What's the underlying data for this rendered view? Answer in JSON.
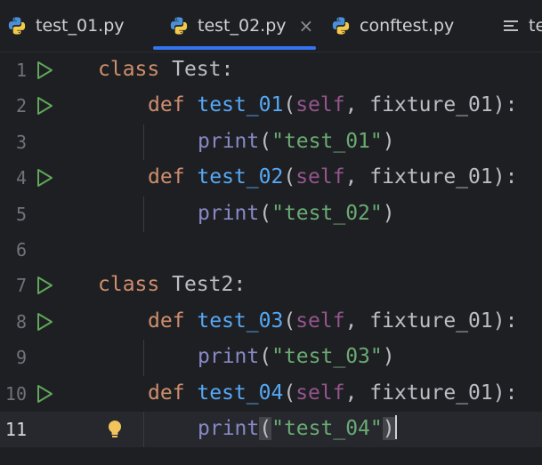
{
  "tabs": [
    {
      "label": "test_01.py",
      "icon": "python-file-icon",
      "active": false
    },
    {
      "label": "test_02.py",
      "icon": "python-file-icon",
      "active": true,
      "close": "×"
    },
    {
      "label": "conftest.py",
      "icon": "python-file-icon",
      "active": false
    },
    {
      "label": "te",
      "icon": "text-file-icon",
      "active": false
    }
  ],
  "colors": {
    "accent": "#3574f0",
    "keyword": "#cf8e6d",
    "function": "#56a8f5",
    "self": "#94558d",
    "builtin": "#8888c6",
    "string": "#6aab73",
    "run_icon": "#5fa759"
  },
  "editor": {
    "lines": [
      {
        "num": "1",
        "run": true,
        "tokens": [
          {
            "t": "class ",
            "c": "kw"
          },
          {
            "t": "Test:",
            "c": "plain"
          }
        ]
      },
      {
        "num": "2",
        "run": true,
        "tokens": [
          {
            "t": "def ",
            "c": "kw"
          },
          {
            "t": "test_01",
            "c": "fn"
          },
          {
            "t": "(",
            "c": "plain"
          },
          {
            "t": "self",
            "c": "self"
          },
          {
            "t": ", fixture_01):",
            "c": "plain"
          }
        ]
      },
      {
        "num": "3",
        "run": false,
        "tokens": [
          {
            "t": "print",
            "c": "builtin"
          },
          {
            "t": "(",
            "c": "plain"
          },
          {
            "t": "\"test_01\"",
            "c": "str"
          },
          {
            "t": ")",
            "c": "plain"
          }
        ]
      },
      {
        "num": "4",
        "run": true,
        "tokens": [
          {
            "t": "def ",
            "c": "kw"
          },
          {
            "t": "test_02",
            "c": "fn"
          },
          {
            "t": "(",
            "c": "plain"
          },
          {
            "t": "self",
            "c": "self"
          },
          {
            "t": ", fixture_01):",
            "c": "plain"
          }
        ]
      },
      {
        "num": "5",
        "run": false,
        "tokens": [
          {
            "t": "print",
            "c": "builtin"
          },
          {
            "t": "(",
            "c": "plain"
          },
          {
            "t": "\"test_02\"",
            "c": "str"
          },
          {
            "t": ")",
            "c": "plain"
          }
        ]
      },
      {
        "num": "6",
        "run": false,
        "tokens": []
      },
      {
        "num": "7",
        "run": true,
        "tokens": [
          {
            "t": "class ",
            "c": "kw"
          },
          {
            "t": "Test2:",
            "c": "plain"
          }
        ]
      },
      {
        "num": "8",
        "run": true,
        "tokens": [
          {
            "t": "def ",
            "c": "kw"
          },
          {
            "t": "test_03",
            "c": "fn"
          },
          {
            "t": "(",
            "c": "plain"
          },
          {
            "t": "self",
            "c": "self"
          },
          {
            "t": ", fixture_01):",
            "c": "plain"
          }
        ]
      },
      {
        "num": "9",
        "run": false,
        "tokens": [
          {
            "t": "print",
            "c": "builtin"
          },
          {
            "t": "(",
            "c": "plain"
          },
          {
            "t": "\"test_03\"",
            "c": "str"
          },
          {
            "t": ")",
            "c": "plain"
          }
        ]
      },
      {
        "num": "10",
        "run": true,
        "tokens": [
          {
            "t": "def ",
            "c": "kw"
          },
          {
            "t": "test_04",
            "c": "fn"
          },
          {
            "t": "(",
            "c": "plain"
          },
          {
            "t": "self",
            "c": "self"
          },
          {
            "t": ", fixture_01):",
            "c": "plain"
          }
        ]
      },
      {
        "num": "11",
        "run": false,
        "current": true,
        "bulb": true,
        "tokens": [
          {
            "t": "print",
            "c": "builtin"
          },
          {
            "t": "(",
            "c": "plain",
            "hl": true
          },
          {
            "t": "\"test_04\"",
            "c": "str"
          },
          {
            "t": ")",
            "c": "plain",
            "hl": true
          }
        ]
      }
    ]
  }
}
